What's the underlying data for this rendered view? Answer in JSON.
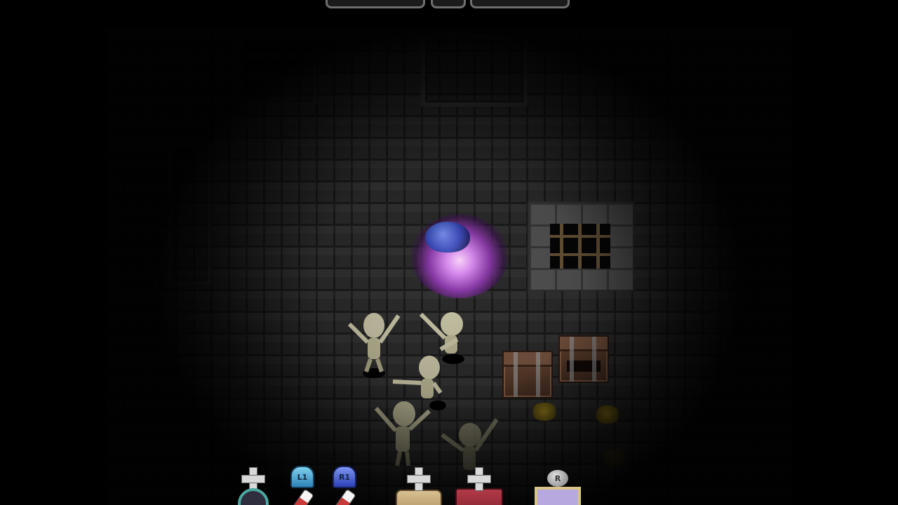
{
  "hud": {
    "top_bars": [
      "health-bar",
      "center-gem",
      "mana-bar"
    ],
    "slots": [
      {
        "id": "dpad-amulet",
        "button": "",
        "icon": "dpad-icon",
        "item": "amulet-icon"
      },
      {
        "id": "l1-potion",
        "button": "L1",
        "icon": "l1-button-icon",
        "item": "potion-icon"
      },
      {
        "id": "r1-potion",
        "button": "R1",
        "icon": "r1-button-icon",
        "item": "potion-icon"
      },
      {
        "id": "dpad-scroll",
        "button": "",
        "icon": "dpad-icon",
        "item": "scroll-icon"
      },
      {
        "id": "dpad-spellbook",
        "button": "",
        "icon": "dpad-icon",
        "item": "spellbook-icon"
      },
      {
        "id": "r-spiral",
        "button": "R",
        "icon": "r-button-icon",
        "item": "spiral-rune-icon"
      }
    ]
  },
  "scene": {
    "entities": [
      "glowing-orb",
      "skeleton",
      "skeleton",
      "skeleton",
      "skeleton",
      "skeleton",
      "treasure-chest",
      "treasure-chest",
      "gold-pile",
      "gold-pile",
      "barred-window"
    ]
  },
  "colors": {
    "floor": "#2c2c2c",
    "orb_glow": "#d98cf0",
    "orb_flame": "#3050c0",
    "chest": "#6e4a35",
    "gold": "#a78c1e",
    "l1_badge": "#2d84b8",
    "r1_badge": "#2d3fb8"
  }
}
